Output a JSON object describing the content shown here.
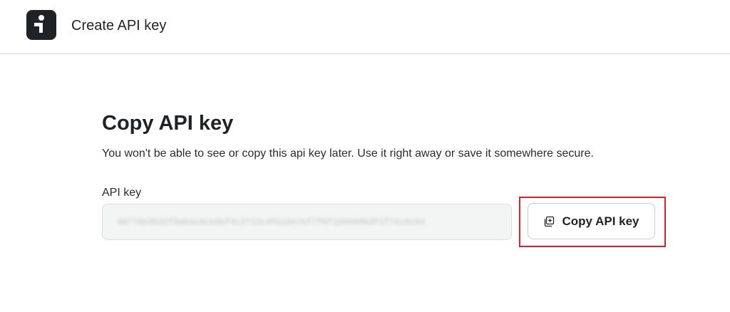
{
  "header": {
    "logo_icon": "brand-logo-icon",
    "title": "Create API key"
  },
  "main": {
    "heading": "Copy API key",
    "description": "You won't be able to see or copy this api key later. Use it right away or save it somewhere secure.",
    "field_label": "API key",
    "api_key_value": "4A77de3b32f5ab4e4cedaf4c3713c4fe1be7ef7f0f2d4689bdf1f74c0c64",
    "copy_button_label": "Copy API key",
    "copy_button_icon": "copy-icon"
  },
  "colors": {
    "highlight": "#d8202a",
    "logo_bg": "#1f2328"
  }
}
